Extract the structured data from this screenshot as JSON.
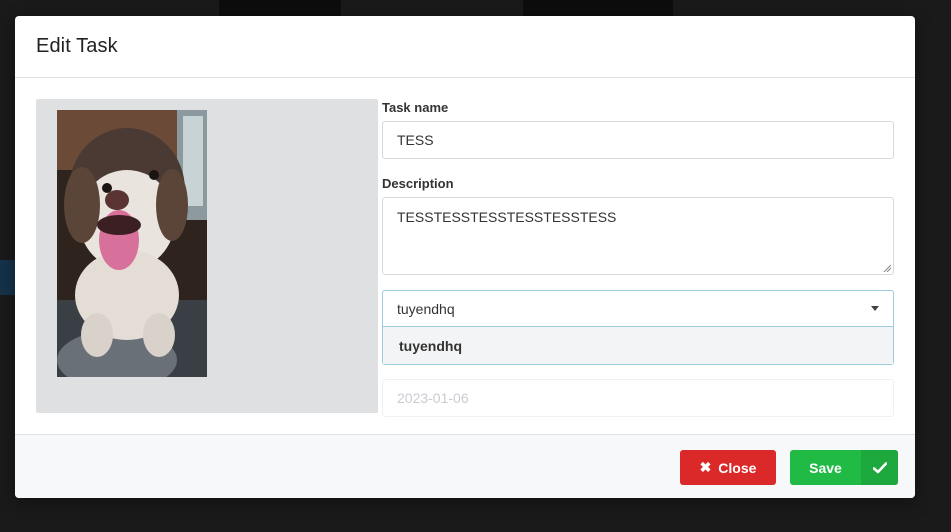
{
  "modal": {
    "title": "Edit Task"
  },
  "form": {
    "task_name_label": "Task name",
    "task_name_value": "TESS",
    "description_label": "Description",
    "description_value": "TESSTESSTESSTESSTESSTESS",
    "assignee_selected": "tuyendhq",
    "assignee_options": [
      "tuyendhq"
    ],
    "date_placeholder": "2023-01-06"
  },
  "footer": {
    "close_label": "Close",
    "save_label": "Save"
  },
  "colors": {
    "close_button": "#db2828",
    "save_button": "#21ba45",
    "select_focus_border": "#9ccbe0"
  },
  "icons": {
    "close": "close-icon",
    "save": "checkmark-icon",
    "dropdown": "chevron-down-icon"
  }
}
